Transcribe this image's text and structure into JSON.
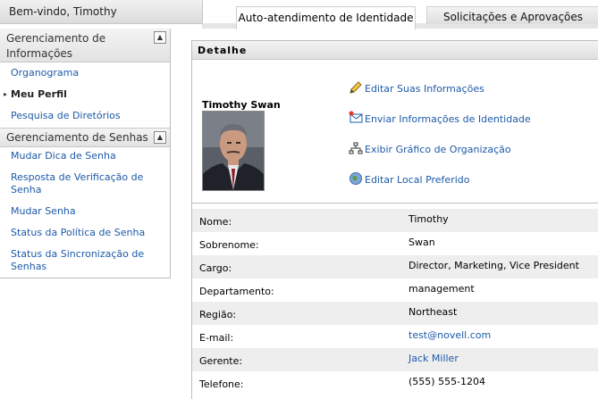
{
  "header": {
    "welcome": "Bem-vindo, Timothy",
    "tabs": [
      {
        "label": "Auto-atendimento de Identidade",
        "active": true
      },
      {
        "label": "Solicitações e Aprovações",
        "active": false
      }
    ]
  },
  "sidebar": {
    "sections": [
      {
        "title": "Gerenciamento de Informações",
        "items": [
          {
            "label": "Organograma",
            "current": false
          },
          {
            "label": "Meu Perfil",
            "current": true
          },
          {
            "label": "Pesquisa de Diretórios",
            "current": false
          }
        ]
      },
      {
        "title": "Gerenciamento de Senhas",
        "items": [
          {
            "label": "Mudar Dica de Senha"
          },
          {
            "label": "Resposta de Verificação de Senha"
          },
          {
            "label": "Mudar Senha"
          },
          {
            "label": "Status da Política de Senha"
          },
          {
            "label": "Status da Sincronização de Senhas"
          }
        ]
      }
    ]
  },
  "detail": {
    "title": "Detalhe",
    "person_name": "Timothy Swan",
    "actions": [
      {
        "label": "Editar Suas Informações",
        "icon": "pencil-icon"
      },
      {
        "label": "Enviar Informações de Identidade",
        "icon": "email-icon"
      },
      {
        "label": "Exibir Gráfico de Organização",
        "icon": "org-chart-icon"
      },
      {
        "label": "Editar Local Preferido",
        "icon": "globe-icon"
      }
    ],
    "fields": [
      {
        "label": "Nome:",
        "value": "Timothy"
      },
      {
        "label": "Sobrenome:",
        "value": "Swan"
      },
      {
        "label": "Cargo:",
        "value": "Director, Marketing, Vice President"
      },
      {
        "label": "Departamento:",
        "value": "management"
      },
      {
        "label": "Região:",
        "value": "Northeast"
      },
      {
        "label": "E-mail:",
        "value": "test@novell.com"
      },
      {
        "label": "Gerente:",
        "value": "Jack Miller"
      },
      {
        "label": "Telefone:",
        "value": "(555) 555-1204"
      }
    ]
  },
  "colors": {
    "link": "#1d5aa8",
    "row_alt": "#eeeeee"
  }
}
